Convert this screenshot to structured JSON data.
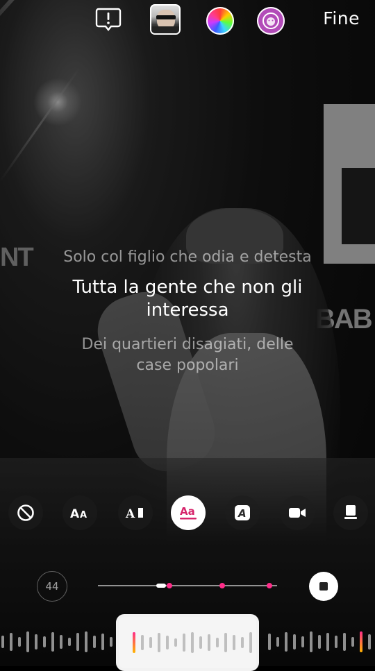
{
  "top_bar": {
    "alert_icon": "alert-speech-bubble-icon",
    "color_wheel_icon": "color-wheel-icon",
    "sticker_icon": "lion-sticker-icon",
    "done_label": "Fine"
  },
  "lyrics": {
    "previous_line": "Solo col figlio che odia e detesta",
    "current_line": "Tutta la gente che non gli interessa",
    "next_line": "Dei quartieri disagiati, delle case popolari"
  },
  "tools": [
    {
      "name": "none",
      "icon": "no-style-icon"
    },
    {
      "name": "font-size",
      "icon": "text-size-icon"
    },
    {
      "name": "text-cursor",
      "icon": "text-cursor-icon"
    },
    {
      "name": "underline",
      "icon": "underline-text-icon",
      "active": true
    },
    {
      "name": "boxed-text",
      "icon": "boxed-text-icon"
    },
    {
      "name": "camera",
      "icon": "video-camera-icon"
    },
    {
      "name": "card",
      "icon": "card-icon"
    }
  ],
  "controls": {
    "size_value": "44",
    "accent_color": "#ff2d8a"
  }
}
